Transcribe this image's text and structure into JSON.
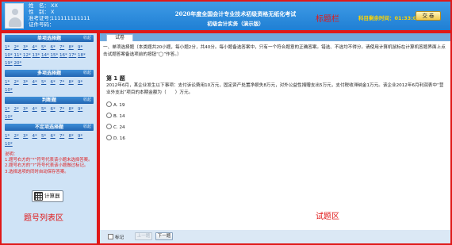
{
  "header": {
    "name_label": "姓　名：",
    "name_value": "XX",
    "gender_label": "性　别：",
    "gender_value": "X",
    "ticket_label": "准考证号：",
    "ticket_value": "111111111111",
    "id_label": "证件号码：",
    "title_line1": "2020年度全国会计专业技术初级资格无纸化考试",
    "title_line2": "初级会计实务（演示版）",
    "zone_label": "标题栏",
    "timer_label": "科目剩余时间：",
    "timer_value": "01:33:09",
    "submit_label": "交 卷"
  },
  "sidebar": {
    "sections": [
      {
        "title": "单项选择题",
        "collapse": "收起",
        "numbers": [
          "1",
          "2",
          "3",
          "4",
          "5",
          "6",
          "7",
          "8",
          "9",
          "10",
          "11",
          "12",
          "13",
          "14",
          "15",
          "16",
          "17",
          "18",
          "19",
          "20"
        ]
      },
      {
        "title": "多项选择题",
        "collapse": "收起",
        "numbers": [
          "1",
          "2",
          "3",
          "4",
          "5",
          "6",
          "7",
          "8",
          "9",
          "10"
        ]
      },
      {
        "title": "判断题",
        "collapse": "收起",
        "numbers": [
          "1",
          "2",
          "3",
          "4",
          "5",
          "6",
          "7",
          "8",
          "9",
          "10"
        ]
      },
      {
        "title": "不定项选择题",
        "collapse": "收起",
        "numbers": [
          "1",
          "2",
          "3",
          "4",
          "5",
          "6",
          "7",
          "8",
          "9",
          "10"
        ]
      }
    ],
    "notes_title": "说明：",
    "notes": [
      "1.题号右方的“*”符号代表该小题未选择答案。",
      "2.题号右方的“?”符号代表该小题做过标记。",
      "3.选择选项的同时自动保存答案。"
    ],
    "calc_label": "计算器",
    "zone_label": "题号列表区"
  },
  "main": {
    "tab_label": "试卷",
    "instructions": "一、单项选择题（本类题共20小题，每小题2分，共40分。每小题备选答案中，只有一个符合题意的正确答案。错选、不选均不得分。请使用计算机鼠标在计算机答题界面上点击试题答案备选项前的按钮“◯”作答。）",
    "question_number": "第 1 题",
    "question_text": "2012年6月，某企业发生以下事项：支付诉讼费用10万元，固定资产处置净损失8万元，对外公益性捐赠支出5万元，支付税收滞纳金1万元。该企业2012年6月利润表中“营业外支出”项目的本期金额为（　　）万元。",
    "options": [
      "A. 19",
      "B. 14",
      "C. 24",
      "D. 16"
    ],
    "mark_label": "标记",
    "prev_label": "上一题",
    "next_label": "下一题",
    "zone_label": "试题区"
  }
}
